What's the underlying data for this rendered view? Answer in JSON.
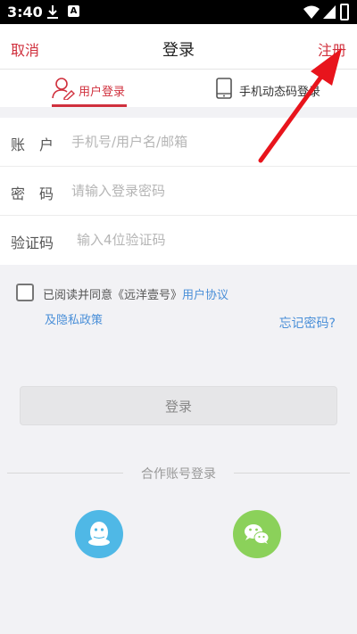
{
  "status_bar": {
    "time": "3:40",
    "icons": [
      "download-icon",
      "notification-a-icon",
      "wifi-icon",
      "signal-icon",
      "battery-icon"
    ]
  },
  "nav": {
    "cancel": "取消",
    "title": "登录",
    "register": "注册"
  },
  "tabs": [
    {
      "label": "用户登录",
      "icon": "user-edit-icon",
      "active": true
    },
    {
      "label": "手机动态码登录",
      "icon": "phone-icon",
      "active": false
    }
  ],
  "form": {
    "account": {
      "label": "账　户",
      "placeholder": "手机号/用户名/邮箱"
    },
    "password": {
      "label": "密　码",
      "placeholder": "请输入登录密码"
    },
    "code": {
      "label": "验证码",
      "placeholder": "输入4位验证码"
    }
  },
  "agreement": {
    "checked": false,
    "prefix": "已阅读并同意《远洋壹号》",
    "link_user": "用户协议",
    "link_privacy": "及隐私政策"
  },
  "forgot_password": "忘记密码?",
  "login_button": "登录",
  "partner": {
    "label": "合作账号登录",
    "options": [
      {
        "name": "qq",
        "icon": "qq-icon",
        "color": "#4fb8e6"
      },
      {
        "name": "wechat",
        "icon": "wechat-icon",
        "color": "#8bd15a"
      }
    ]
  },
  "colors": {
    "accent": "#d0303d",
    "link": "#4a8fd8",
    "annotation_arrow": "#e8141c"
  }
}
